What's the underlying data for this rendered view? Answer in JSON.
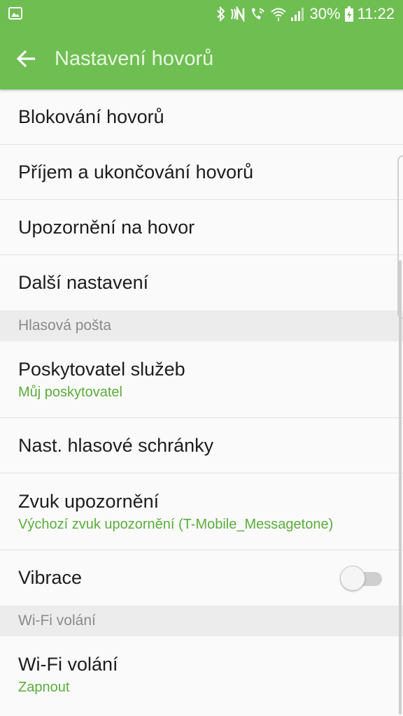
{
  "status_bar": {
    "battery_percent": "30%",
    "time": "11:22",
    "icons": [
      "gallery-icon",
      "bluetooth-icon",
      "nfc-icon",
      "wifi-call-icon",
      "wifi-icon",
      "signal-icon",
      "battery-charging-icon"
    ]
  },
  "app_bar": {
    "title": "Nastavení hovorů",
    "back_icon": "arrow-left-icon",
    "color": "#6fbe52"
  },
  "groups": {
    "general": {
      "items": [
        {
          "title": "Blokování hovorů"
        },
        {
          "title": "Příjem a ukončování hovorů"
        },
        {
          "title": "Upozornění na hovor"
        },
        {
          "title": "Další nastavení"
        }
      ]
    },
    "voicemail": {
      "header": "Hlasová pošta",
      "items": [
        {
          "title": "Poskytovatel služeb",
          "subtitle": "Můj poskytovatel"
        },
        {
          "title": "Nast. hlasové schránky"
        },
        {
          "title": "Zvuk upozornění",
          "subtitle": "Výchozí zvuk upozornění (T-Mobile_Messagetone)"
        },
        {
          "title": "Vibrace",
          "toggle_on": false
        }
      ]
    },
    "wifi": {
      "header": "Wi-Fi volání",
      "items": [
        {
          "title": "Wi-Fi volání",
          "subtitle": "Zapnout"
        }
      ]
    }
  },
  "colors": {
    "accent": "#5aad3b",
    "section_bg": "#ececec",
    "background": "#fafafa"
  }
}
